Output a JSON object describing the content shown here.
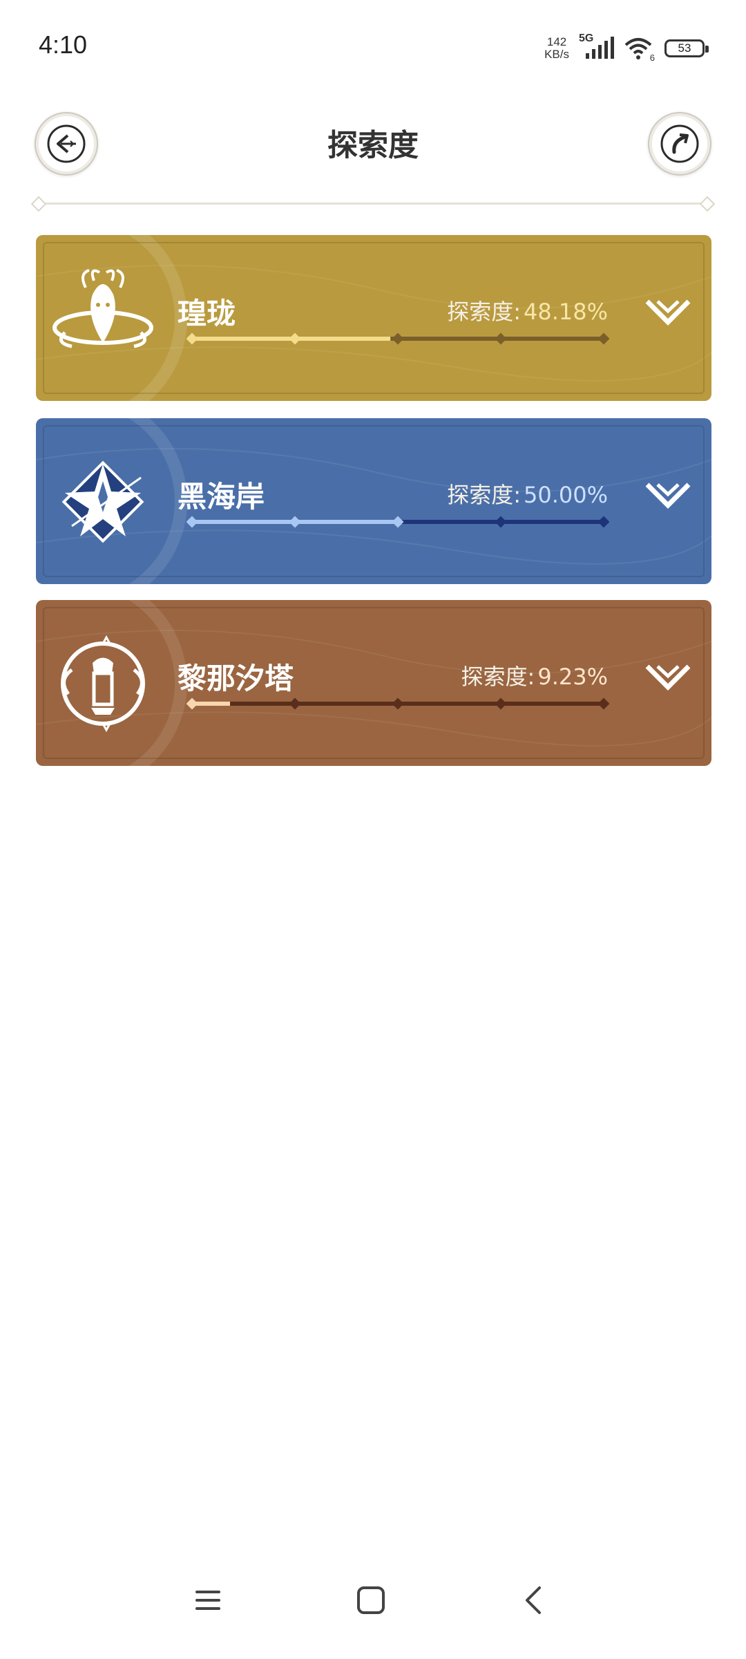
{
  "status_bar": {
    "time": "4:10",
    "net_speed_value": "142",
    "net_speed_unit": "KB/s",
    "network_type": "5G",
    "wifi_level": "6",
    "battery": "53"
  },
  "header": {
    "title": "探索度"
  },
  "regions": [
    {
      "name": "瑝珑",
      "progress_label": "探索度:",
      "progress_text": "48.18%",
      "progress_value": 0.4818,
      "theme": "gold",
      "colors": {
        "card": "#b99a3e",
        "fill": "#f4dc8c",
        "track": "#7a5f2a"
      },
      "icon": "dragon-emblem-icon"
    },
    {
      "name": "黑海岸",
      "progress_label": "探索度:",
      "progress_text": "50.00%",
      "progress_value": 0.5,
      "theme": "blue",
      "colors": {
        "card": "#4a6fa8",
        "fill": "#a9c7f3",
        "track": "#1f3478"
      },
      "icon": "star-crystal-emblem-icon"
    },
    {
      "name": "黎那汐塔",
      "progress_label": "探索度:",
      "progress_text": "9.23%",
      "progress_value": 0.0923,
      "theme": "brown",
      "colors": {
        "card": "#9a6540",
        "fill": "#f7d6b0",
        "track": "#5a2e1c"
      },
      "icon": "tower-emblem-icon"
    }
  ],
  "nav": {
    "icons": [
      "menu-icon",
      "home-icon",
      "back-icon"
    ]
  }
}
